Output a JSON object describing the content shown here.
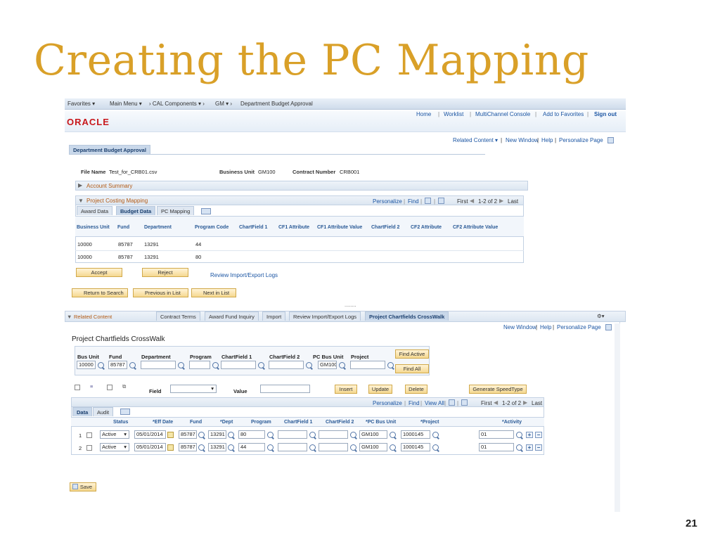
{
  "slide": {
    "title": "Creating the PC Mapping",
    "page_number": "21"
  },
  "nav": {
    "items": [
      "Favorites",
      "Main Menu",
      "CAL Components",
      "GM",
      "Department Budget Approval"
    ],
    "right_links": [
      "Home",
      "Worklist",
      "MultiChannel Console",
      "Add to Favorites",
      "Sign out"
    ]
  },
  "brand": {
    "logo": "ORACLE"
  },
  "toplinks": {
    "related": "Related Content",
    "new_window": "New Window",
    "help": "Help",
    "personalize": "Personalize Page"
  },
  "page_tab": "Department Budget Approval",
  "file_info": {
    "file_name_label": "File Name",
    "file_name": "Test_for_CRB01.csv",
    "bu_label": "Business Unit",
    "bu": "GM100",
    "contract_label": "Contract Number",
    "contract": "CRB001"
  },
  "account_summary": "Account Summary",
  "pc_mapping": {
    "header": "Project Costing Mapping",
    "personalize": "Personalize",
    "find": "Find",
    "first": "First",
    "range": "1-2 of 2",
    "last": "Last",
    "tabs": [
      "Award Data",
      "Budget Data",
      "PC Mapping"
    ],
    "columns": [
      "Business Unit",
      "Fund",
      "Department",
      "Program Code",
      "ChartField 1",
      "CF1 Attribute",
      "CF1 Attribute Value",
      "ChartField 2",
      "CF2 Attribute",
      "CF2 Attribute Value"
    ],
    "rows": [
      [
        "10000",
        "85787",
        "13291",
        "44"
      ],
      [
        "10000",
        "85787",
        "13291",
        "80"
      ]
    ]
  },
  "actions": {
    "accept": "Accept",
    "reject": "Reject",
    "review_logs": "Review Import/Export Logs"
  },
  "list_nav": {
    "return": "Return to Search",
    "previous": "Previous in List",
    "next": "Next in List"
  },
  "dots": "........",
  "related_bar": {
    "label": "Related Content",
    "tabs": [
      "Contract Terms",
      "Award Fund Inquiry",
      "Import",
      "Review Import/Export Logs",
      "Project Chartfields CrossWalk"
    ],
    "settings": "⚙▾"
  },
  "lower_links": {
    "new_window": "New Window",
    "help": "Help",
    "personalize": "Personalize Page"
  },
  "crosswalk": {
    "title": "Project Chartfields CrossWalk",
    "search_labels": [
      "Bus Unit",
      "Fund",
      "Department",
      "Program",
      "ChartField 1",
      "ChartField 2",
      "PC Bus Unit",
      "Project"
    ],
    "search_values": [
      "10000",
      "85787",
      "",
      "",
      "",
      "",
      "GM100",
      ""
    ],
    "find_active": "Find Active",
    "find_all": "Find All",
    "field_label": "Field",
    "value_label": "Value",
    "insert": "Insert",
    "update": "Update",
    "delete": "Delete",
    "generate": "Generate SpeedType",
    "grid_personalize": "Personalize",
    "grid_find": "Find",
    "grid_viewall": "View All",
    "grid_first": "First",
    "grid_range": "1-2 of 2",
    "grid_last": "Last",
    "tabs": [
      "Data",
      "Audit"
    ],
    "columns": [
      "Status",
      "*Eff Date",
      "Fund",
      "*Dept",
      "Program",
      "ChartField 1",
      "ChartField 2",
      "*PC Bus Unit",
      "*Project",
      "*Activity"
    ],
    "rows": [
      {
        "num": "1",
        "status": "Active",
        "eff_date": "05/01/2014",
        "fund": "85787",
        "dept": "13291",
        "program": "80",
        "cf1": "",
        "cf2": "",
        "pc_bu": "GM100",
        "project": "1000145",
        "activity": "01"
      },
      {
        "num": "2",
        "status": "Active",
        "eff_date": "05/01/2014",
        "fund": "85787",
        "dept": "13291",
        "program": "44",
        "cf1": "",
        "cf2": "",
        "pc_bu": "GM100",
        "project": "1000145",
        "activity": "01"
      }
    ],
    "save": "Save"
  }
}
